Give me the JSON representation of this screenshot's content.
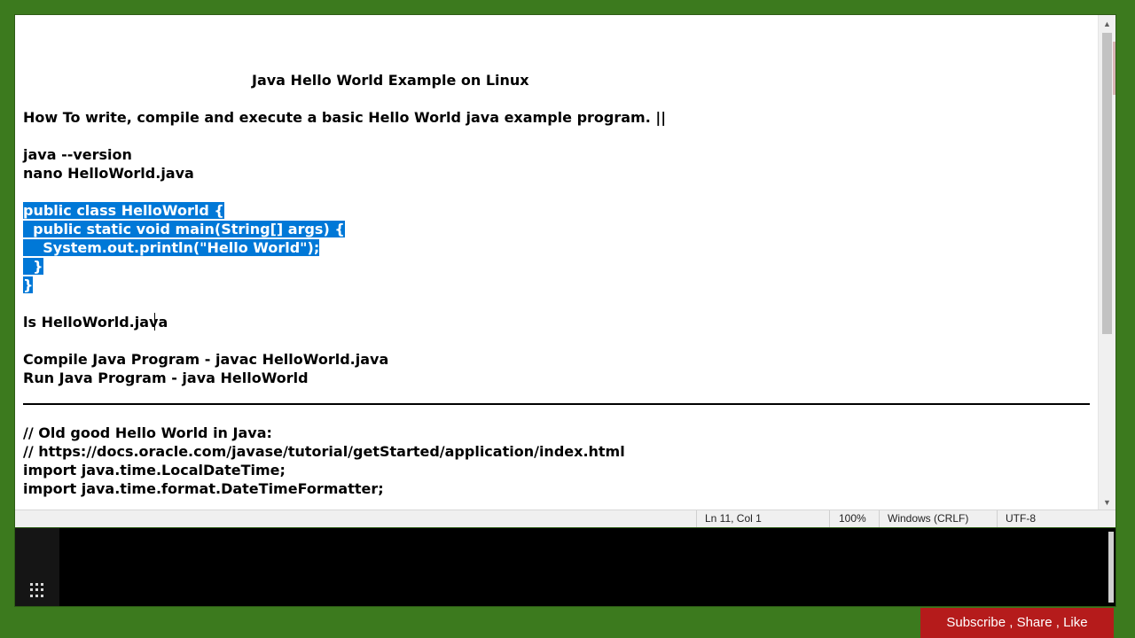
{
  "editor": {
    "lines": [
      "Java Hello World Example on Linux",
      "How To write, compile and execute a basic Hello World java example program. ||",
      "java --version",
      "nano HelloWorld.java",
      "public class HelloWorld {",
      "  public static void main(String[] args) {",
      "    System.out.println(\"Hello World\");",
      "  }",
      "}",
      "ls HelloWorld.java",
      "Compile Java Program - javac HelloWorld.java",
      "Run Java Program - java HelloWorld",
      "// Old good Hello World in Java:",
      "// https://docs.oracle.com/javase/tutorial/getStarted/application/index.html",
      "import java.time.LocalDateTime;",
      "import java.time.format.DateTimeFormatter;"
    ]
  },
  "status_bar": {
    "position": "Ln 11, Col 1",
    "zoom": "100%",
    "line_ending": "Windows (CRLF)",
    "encoding": "UTF-8"
  },
  "scrollbar": {
    "up_icon": "▲",
    "down_icon": "▼"
  },
  "banner": {
    "text": "Subscribe , Share ,  Like"
  },
  "colors": {
    "selection": "#0078d7",
    "background_green": "#3c7a1e",
    "banner_red": "#b51b1b"
  }
}
